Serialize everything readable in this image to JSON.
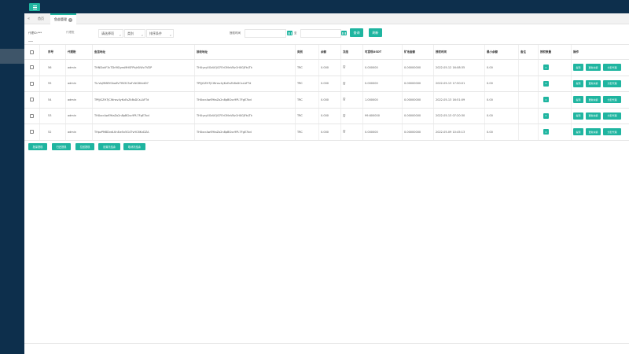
{
  "topbar": {
    "menu_icon": "hamburger-icon"
  },
  "tabs": {
    "back_icon": "double-chevron-left-icon",
    "items": [
      {
        "label": "首页"
      },
      {
        "label": "鱼苗管理",
        "active": true,
        "close_icon": "close-icon"
      }
    ]
  },
  "filter": {
    "agent_label": "代理ID:***",
    "agent_placeholder": "代理账",
    "select_project": "请选择项",
    "select_type": "类别",
    "select_sort": "排序条件",
    "time_label": "授权时间",
    "date_separator": "至",
    "date_from": "",
    "date_to": "",
    "query_button": "查询",
    "refresh_button": "刷新"
  },
  "table": {
    "headers": [
      "",
      "序号",
      "代理账",
      "鱼苗地址",
      "接收地址",
      "类别",
      "余额",
      "冻结",
      "可提现USDT",
      "矿池金额",
      "授权时间",
      "最小余额",
      "备注",
      "授权数量",
      "操作"
    ],
    "rows": [
      {
        "id": "56",
        "agent": "admin",
        "addr": "THNDxkF3cTDrMGyesMHSFPbJrSiWv7VDP",
        "recv": "THUyzyXGdUQiCFErGMnVNz1HXGJFtrJTk",
        "type": "TRC",
        "balance": "0.000",
        "frozen": "否",
        "usdt": "0.000000",
        "pool": "0.00000000",
        "time": "2022-05-12 16:08:35",
        "min": "0.00",
        "note": "",
        "auth": "0"
      },
      {
        "id": "55",
        "agent": "admin",
        "addr": "TLrVoJ9M8YGko6V7fN3C5oFcNC8hbtD7",
        "recv": "TPfjjGZH7JCWnsv4yKxEsZk8sDCsLAFTd",
        "type": "TRC",
        "balance": "0.000",
        "frozen": "否",
        "usdt": "0.000000",
        "pool": "0.00000000",
        "time": "2022-05-13 17:50:01",
        "min": "0.00",
        "note": "",
        "auth": "0"
      },
      {
        "id": "54",
        "agent": "admin",
        "addr": "TPfjjGZH7JCWnsv4yKxEsZk8sDCsLAFTd",
        "recv": "THXxcrAwE9taZo2n8pBGvc9PL7FgE7bd",
        "type": "TRC",
        "balance": "0.000",
        "frozen": "否",
        "usdt": "1.000000",
        "pool": "0.00000000",
        "time": "2022-05-13 16:51:09",
        "min": "0.00",
        "note": "",
        "auth": "0"
      },
      {
        "id": "53",
        "agent": "admin",
        "addr": "THXxcrAwE9taZo2n8pBGvc9PL7FgE7bd",
        "recv": "THUyzyXGdUQiCFErGMnVNz1HXGJFtrJTk",
        "type": "TRC",
        "balance": "0.000",
        "frozen": "否",
        "usdt": "99.600000",
        "pool": "0.00000000",
        "time": "2022-05-13 07:20:30",
        "min": "0.00",
        "note": "",
        "auth": "0"
      },
      {
        "id": "52",
        "agent": "admin",
        "addr": "THpzPM8DvdLKnEw5x5G4TvHC6KvDZA",
        "recv": "THXxcrAwE9taZo2n8pBGvc9PL7FgE7bd",
        "type": "TRC",
        "balance": "0.000",
        "frozen": "否",
        "usdt": "0.000000",
        "pool": "0.00000000",
        "time": "2022-05-09 10:45:13",
        "min": "0.00",
        "note": "",
        "auth": "0"
      }
    ],
    "actions": [
      "提现",
      "更新余额",
      "分配代理"
    ]
  },
  "bulk": [
    "批量提现",
    "归还提现",
    "拉回提现",
    "设置冻结余",
    "取消冻结余"
  ],
  "colors": {
    "accent": "#1fb5a0",
    "nav": "#0d2f4c"
  }
}
